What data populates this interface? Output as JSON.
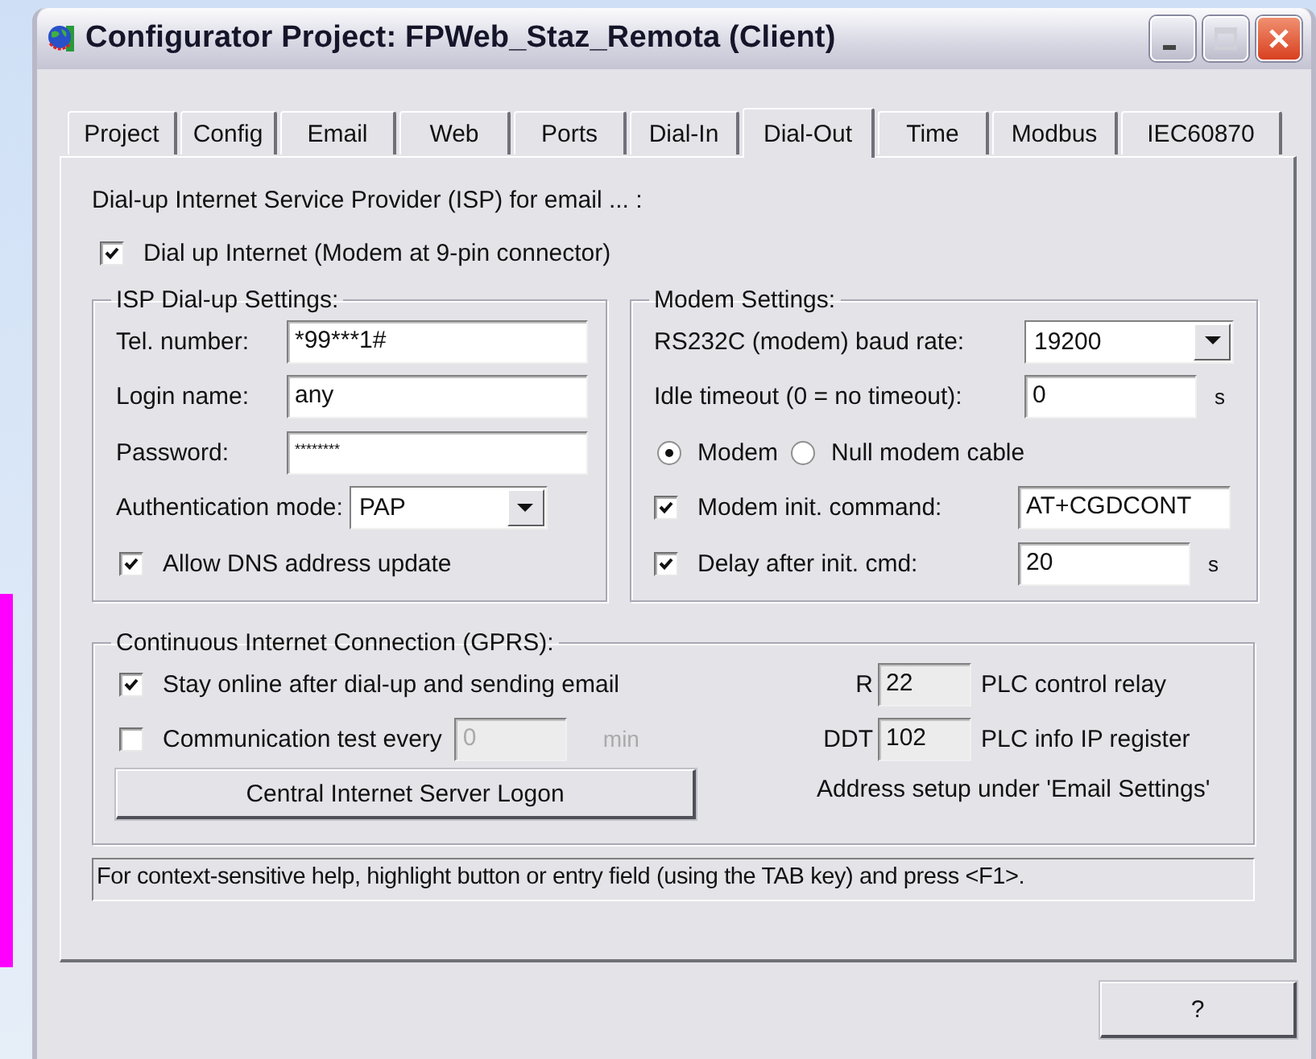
{
  "window": {
    "title": "Configurator Project: FPWeb_Staz_Remota (Client)"
  },
  "tabs": [
    {
      "label": "Project",
      "selected": false
    },
    {
      "label": "Config",
      "selected": false
    },
    {
      "label": "Email",
      "selected": false
    },
    {
      "label": "Web",
      "selected": false
    },
    {
      "label": "Ports",
      "selected": false
    },
    {
      "label": "Dial-In",
      "selected": false
    },
    {
      "label": "Dial-Out",
      "selected": true
    },
    {
      "label": "Time",
      "selected": false
    },
    {
      "label": "Modbus",
      "selected": false
    },
    {
      "label": "IEC60870",
      "selected": false
    }
  ],
  "intro": "Dial-up Internet Service Provider (ISP) for email ... :",
  "dial_up": {
    "label": "Dial up Internet (Modem at 9-pin connector)",
    "checked": true
  },
  "isp_settings": {
    "title": "ISP Dial-up Settings:",
    "fields": [
      {
        "label": "Tel. number:",
        "value": "*99***1#"
      },
      {
        "label": "Login name:",
        "value": "any"
      },
      {
        "label": "Password:",
        "value": "********"
      }
    ],
    "auth": {
      "label": "Authentication mode:",
      "value": "PAP"
    },
    "allow_dns": {
      "label": "Allow DNS address update",
      "checked": true
    }
  },
  "modem_settings": {
    "title": "Modem Settings:",
    "baud": {
      "label": "RS232C (modem) baud rate:",
      "value": "19200"
    },
    "idle": {
      "label": "Idle timeout (0 = no timeout):",
      "value": "0",
      "unit": "s"
    },
    "connection": [
      {
        "label": "Modem",
        "selected": true
      },
      {
        "label": "Null modem cable",
        "selected": false
      }
    ],
    "init_command": {
      "label": "Modem init. command:",
      "checked": true,
      "value": "AT+CGDCONT"
    },
    "delay": {
      "label": "Delay after init. cmd:",
      "checked": true,
      "value": "20",
      "unit": "s"
    }
  },
  "gprs": {
    "title": "Continuous Internet Connection (GPRS):",
    "stay_online": {
      "label": "Stay online after dial-up and sending email",
      "checked": true
    },
    "comm_test": {
      "label": "Communication test every",
      "checked": false,
      "value": "0",
      "unit": "min",
      "disabled": true
    },
    "logon_button": "Central Internet Server Logon",
    "registers": [
      {
        "prefix": "R",
        "value": "22",
        "label": "PLC control relay"
      },
      {
        "prefix": "DDT",
        "value": "102",
        "label": "PLC info IP register"
      }
    ],
    "note": "Address setup under 'Email Settings'"
  },
  "help_text": "For context-sensitive help, highlight button or entry field (using the TAB key) and press <F1>.",
  "buttons": [
    "?"
  ]
}
